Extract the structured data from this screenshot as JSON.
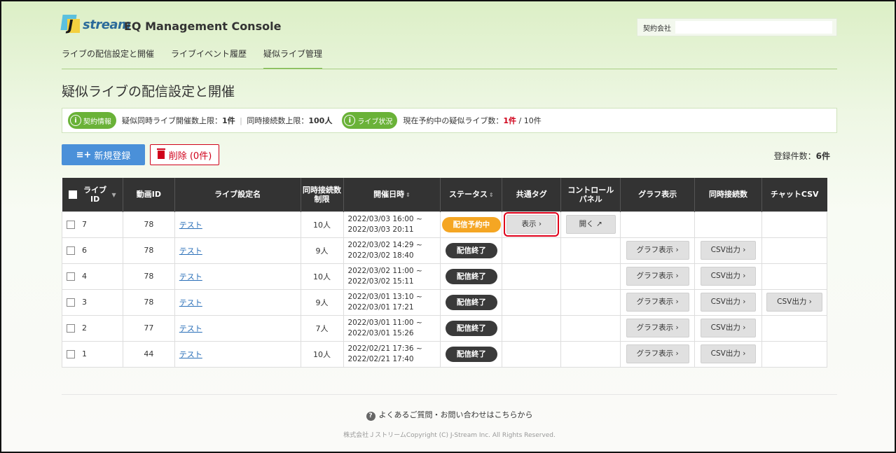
{
  "header": {
    "logo_text": "stream",
    "logo_letter": "J",
    "app_title": "EQ Management Console",
    "contract_label": "契約会社",
    "contract_value": ""
  },
  "nav": [
    "ライブの配信設定と開催",
    "ライブイベント履歴",
    "疑似ライブ管理"
  ],
  "nav_active": 2,
  "page_title": "疑似ライブの配信設定と開催",
  "info": {
    "badge1": "契約情報",
    "text1_prefix": "疑似同時ライブ開催数上限：",
    "text1_val": "1件",
    "text1_sep": "|",
    "text1_prefix2": "同時接続数上限：",
    "text1_val2": "100人",
    "badge2": "ライブ状況",
    "text2_prefix": "現在予約中の疑似ライブ数：",
    "text2_val": "1件",
    "text2_suffix": " / 10件"
  },
  "actions": {
    "new_label": "新規登録",
    "delete_label": "削除 (0件)",
    "count_prefix": "登録件数：",
    "count_val": "6件"
  },
  "table": {
    "headers": {
      "live_id": "ライブ ID",
      "video_id": "動画ID",
      "name": "ライブ設定名",
      "limit": "同時接続数 制限",
      "date": "開催日時",
      "status": "ステータス",
      "tag": "共通タグ",
      "panel": "コントロール パネル",
      "graph": "グラフ表示",
      "conc": "同時接続数",
      "chat": "チャットCSV"
    },
    "rows": [
      {
        "id": "7",
        "video": "78",
        "name": "テスト",
        "limit": "10人",
        "start": "2022/03/03 16:00 ~",
        "end": "2022/03/03 20:11",
        "status": "配信予約中",
        "tag": "表示 ›",
        "panel": "開く",
        "graph": "",
        "conc": "",
        "chat": ""
      },
      {
        "id": "6",
        "video": "78",
        "name": "テスト",
        "limit": "9人",
        "start": "2022/03/02 14:29 ~",
        "end": "2022/03/02 18:40",
        "status": "配信終了",
        "tag": "",
        "panel": "",
        "graph": "グラフ表示 ›",
        "conc": "CSV出力 ›",
        "chat": ""
      },
      {
        "id": "4",
        "video": "78",
        "name": "テスト",
        "limit": "10人",
        "start": "2022/03/02 11:00 ~",
        "end": "2022/03/02 15:11",
        "status": "配信終了",
        "tag": "",
        "panel": "",
        "graph": "グラフ表示 ›",
        "conc": "CSV出力 ›",
        "chat": ""
      },
      {
        "id": "3",
        "video": "78",
        "name": "テスト",
        "limit": "9人",
        "start": "2022/03/01 13:10 ~",
        "end": "2022/03/01 17:21",
        "status": "配信終了",
        "tag": "",
        "panel": "",
        "graph": "グラフ表示 ›",
        "conc": "CSV出力 ›",
        "chat": "CSV出力 ›"
      },
      {
        "id": "2",
        "video": "77",
        "name": "テスト",
        "limit": "7人",
        "start": "2022/03/01 11:00 ~",
        "end": "2022/03/01 15:26",
        "status": "配信終了",
        "tag": "",
        "panel": "",
        "graph": "グラフ表示 ›",
        "conc": "CSV出力 ›",
        "chat": ""
      },
      {
        "id": "1",
        "video": "44",
        "name": "テスト",
        "limit": "10人",
        "start": "2022/02/21 17:36 ~",
        "end": "2022/02/21 17:40",
        "status": "配信終了",
        "tag": "",
        "panel": "",
        "graph": "グラフ表示 ›",
        "conc": "CSV出力 ›",
        "chat": ""
      }
    ]
  },
  "footer": {
    "faq": "よくあるご質問・お問い合わせはこちらから",
    "copyright": "株式会社ＪストリームCopyright (C) J-Stream Inc. All Rights Reserved."
  },
  "colors": {
    "accent_green": "#6ab238",
    "primary_blue": "#4a90d9",
    "danger_red": "#d0021b",
    "scheduled_orange": "#f5a623",
    "ended_dark": "#3a3a3a",
    "highlight_red": "#e0001b"
  }
}
